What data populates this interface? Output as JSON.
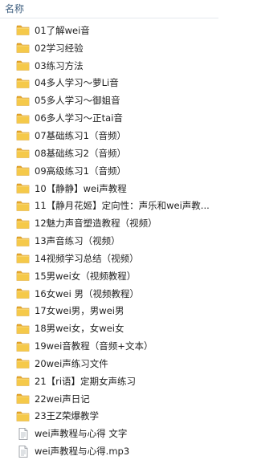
{
  "header": {
    "name_label": "名称"
  },
  "items": [
    {
      "label": "01了解wei音",
      "type": "folder"
    },
    {
      "label": "02学习经验",
      "type": "folder"
    },
    {
      "label": "03练习方法",
      "type": "folder"
    },
    {
      "label": "04多人学习～萝Li音",
      "type": "folder"
    },
    {
      "label": "05多人学习～御姐音",
      "type": "folder"
    },
    {
      "label": "06多人学习～正tai音",
      "type": "folder"
    },
    {
      "label": "07基础练习1（音频）",
      "type": "folder"
    },
    {
      "label": "08基础练习2（音频）",
      "type": "folder"
    },
    {
      "label": "09高级练习1（音频）",
      "type": "folder"
    },
    {
      "label": "10【静静】wei声教程",
      "type": "folder"
    },
    {
      "label": "11【静月花姬】定向性：声乐和wei声教...",
      "type": "folder"
    },
    {
      "label": "12魅力声音塑造教程（视频）",
      "type": "folder"
    },
    {
      "label": "13声音练习（视频）",
      "type": "folder"
    },
    {
      "label": "14视频学习总结（视频）",
      "type": "folder"
    },
    {
      "label": "15男wei女（视频教程）",
      "type": "folder"
    },
    {
      "label": "16女wei 男（视频教程）",
      "type": "folder"
    },
    {
      "label": "17女wei男，男wei男",
      "type": "folder"
    },
    {
      "label": "18男wei女，女wei女",
      "type": "folder"
    },
    {
      "label": "19wei音教程（音频+文本）",
      "type": "folder"
    },
    {
      "label": "20wei声练习文件",
      "type": "folder"
    },
    {
      "label": "21【ri语】定期女声练习",
      "type": "folder"
    },
    {
      "label": "22wei声日记",
      "type": "folder"
    },
    {
      "label": "23王Z荣爆教学",
      "type": "folder"
    },
    {
      "label": "wei声教程与心得 文字",
      "type": "file"
    },
    {
      "label": "wei声教程与心得.mp3",
      "type": "file"
    }
  ],
  "icons": {
    "folder": "folder-icon",
    "file": "document-icon"
  },
  "colors": {
    "folder_body": "#f5c94a",
    "folder_tab": "#e8a92a",
    "folder_edge": "#c78a1c",
    "header_text": "#3f5f80"
  }
}
